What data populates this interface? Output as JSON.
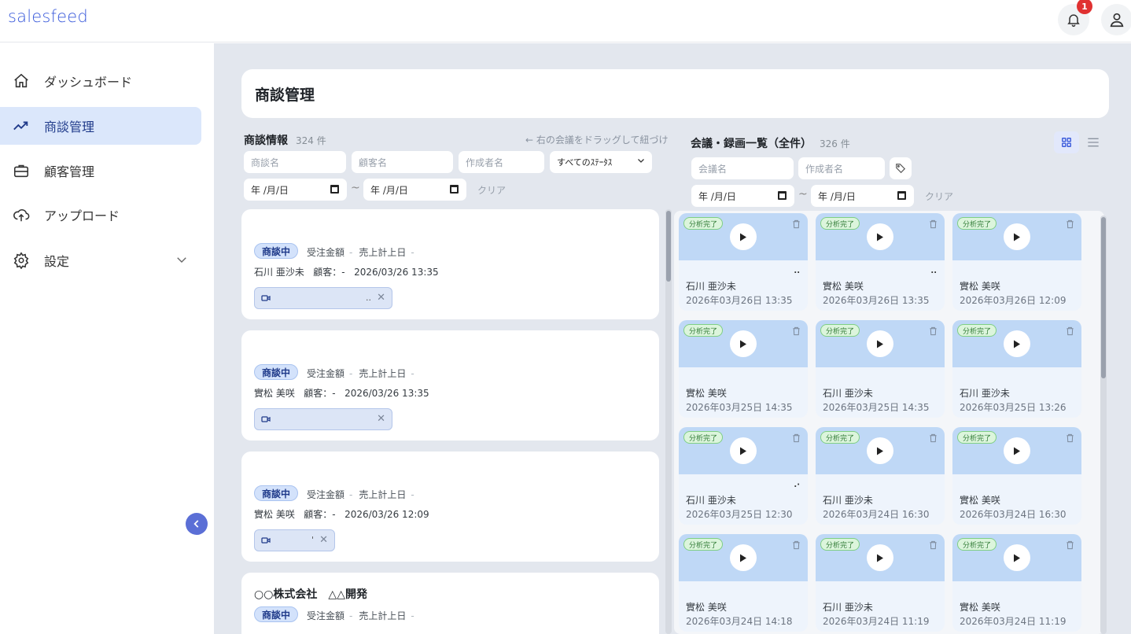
{
  "header": {
    "logo": "salesfeed",
    "notification_count": "1"
  },
  "sidebar": {
    "items": [
      {
        "label": "ダッシュボード",
        "icon": "home-icon"
      },
      {
        "label": "商談管理",
        "icon": "trend-icon",
        "active": true
      },
      {
        "label": "顧客管理",
        "icon": "briefcase-icon"
      },
      {
        "label": "アップロード",
        "icon": "upload-cloud-icon"
      },
      {
        "label": "設定",
        "icon": "gear-icon"
      }
    ]
  },
  "page": {
    "title": "商談管理"
  },
  "deals": {
    "title": "商談情報",
    "count": "324 件",
    "hint": "← 右の会議をドラッグして紐づけ",
    "filters": {
      "name_placeholder": "商談名",
      "customer_placeholder": "顧客名",
      "creator_placeholder": "作成者名",
      "status_value": "すべてのｽﾃｰﾀｽ",
      "date_from": "年 /月/日",
      "date_to": "年 /月/日",
      "tilde": "~",
      "clear": "クリア"
    },
    "items": [
      {
        "title": "",
        "status": "商談中",
        "amount_label": "受注金額",
        "amount": "-",
        "sales_date_label": "売上計上日",
        "sales_date": "-",
        "owner": "石川 亜沙未",
        "customer": "顧客：-",
        "datetime": "2026/03/26 13:35",
        "chip_text": ".."
      },
      {
        "title": "",
        "status": "商談中",
        "amount_label": "受注金額",
        "amount": "-",
        "sales_date_label": "売上計上日",
        "sales_date": "-",
        "owner": "實松 美咲",
        "customer": "顧客：-",
        "datetime": "2026/03/26 13:35",
        "chip_text": ""
      },
      {
        "title": "",
        "status": "商談中",
        "amount_label": "受注金額",
        "amount": "-",
        "sales_date_label": "売上計上日",
        "sales_date": "-",
        "owner": "實松 美咲",
        "customer": "顧客：-",
        "datetime": "2026/03/26 12:09",
        "chip_text": "'"
      },
      {
        "title": "○○株式会社　△△開発",
        "status": "商談中",
        "amount_label": "受注金額",
        "amount": "-",
        "sales_date_label": "売上計上日",
        "sales_date": "-"
      }
    ]
  },
  "meetings": {
    "title": "会議・録画一覧（全件）",
    "count": "326 件",
    "filters": {
      "name_placeholder": "会議名",
      "creator_placeholder": "作成者名",
      "date_from": "年 /月/日",
      "date_to": "年 /月/日",
      "tilde": "~",
      "clear": "クリア"
    },
    "badge": "分析完了",
    "items": [
      {
        "name": "石川 亜沙未",
        "date": "2026年03月26日 13:35",
        "dots": ".."
      },
      {
        "name": "實松 美咲",
        "date": "2026年03月26日 13:35",
        "dots": ".."
      },
      {
        "name": "實松 美咲",
        "date": "2026年03月26日 12:09",
        "dots": ""
      },
      {
        "name": "實松 美咲",
        "date": "2026年03月25日 14:35",
        "dots": ""
      },
      {
        "name": "石川 亜沙未",
        "date": "2026年03月25日 14:35",
        "dots": ""
      },
      {
        "name": "石川 亜沙未",
        "date": "2026年03月25日 13:26",
        "dots": ""
      },
      {
        "name": "石川 亜沙未",
        "date": "2026年03月25日 12:30",
        "dots": ".·"
      },
      {
        "name": "石川 亜沙未",
        "date": "2026年03月24日 16:30",
        "dots": ""
      },
      {
        "name": "實松 美咲",
        "date": "2026年03月24日 16:30",
        "dots": ""
      },
      {
        "name": "實松 美咲",
        "date": "2026年03月24日 14:18",
        "dots": ""
      },
      {
        "name": "石川 亜沙未",
        "date": "2026年03月24日 11:19",
        "dots": ""
      },
      {
        "name": "實松 美咲",
        "date": "2026年03月24日 11:19",
        "dots": ""
      }
    ]
  }
}
